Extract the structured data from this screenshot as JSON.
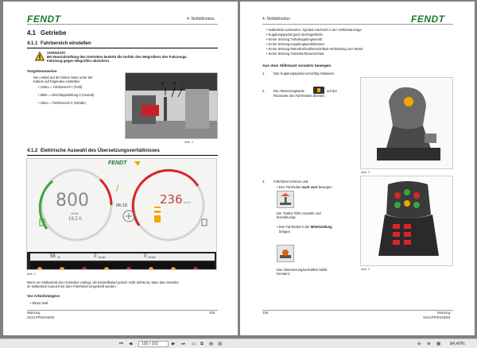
{
  "left_page": {
    "logo": "FENDT",
    "chapter": "4. Notfallmodus",
    "section_number": "4.1",
    "section_title": "Getriebe",
    "sub1_number": "4.1.1",
    "sub1_title": "Fahrbereich einstellen",
    "warning_title": "VORSICHT:",
    "warning_line1": "Bei Neutralstellung des Getriebes besteht die Gefahr des Wegrollens des Fahrzeugs.",
    "warning_line2": "Fahrzeug gegen Wegrollen absichern.",
    "procedure_title": "Vorgehensweise",
    "procedure_intro1": "Den Hebel auf der linken Seite unter der",
    "procedure_intro2": "Kabine auf folgendes einstellen",
    "bullets": [
      "Unten = Fahrbereich I (Feld)",
      "Mitte = Abschleppstellung 0 (neutral)",
      "Oben = Fahrbereich II (Straße)"
    ],
    "fig1_caption": "Abb. 1",
    "fig1_labels": [
      "II",
      "0",
      "I"
    ],
    "sub2_number": "4.1.2",
    "sub2_title": "Elektrische Auswahl des Übersetzungsverhältnisses",
    "dashboard": {
      "brand": "FENDT",
      "rpm_value": "800",
      "rpm_unit": "1/min",
      "hours_value": "19,2 h",
      "time": "06:19",
      "speed_value": "236",
      "speed_unit": "km/h",
      "bottom_pct": "58",
      "bottom_pct_unit": "%",
      "bottom_rpm1": "0",
      "bottom_rpm1_unit": "1/min",
      "bottom_rpm2": "0",
      "bottom_rpm2_unit": "1/min"
    },
    "fig2_caption": "Abb. 2",
    "para1": "Wenn ein Notbetrieb des Getriebes vorliegt, die Einstellhebel jedoch nicht defekt ist, kann das Getriebe",
    "para2": "im Notbetrieb manuell mit dem Fahrhebel eingestellt werden.",
    "before_title": "Vor Arbeitsbeginn",
    "before_bullet": "Motor läuft",
    "footer_left1": "Wartung",
    "footer_left2": "SS21PP001N003",
    "page_number": "105"
  },
  "right_page": {
    "logo": "FENDT",
    "chapter": "4. Notfallmodus",
    "bullets": [
      "Notbetrieb vorhanden; Symbol erscheint in der Vielfachanzeige.",
      "Kupplungspedal ganz durchgedrückt.",
      "Keine Störung Turbokupplungsventil.",
      "Keine Störung Kupplungspedalsensor.",
      "Keine Störung Motordrehzahlsensor/Bus-Verbindung zum Motor.",
      "Keine Störung Getriebe/Steuereinheit."
    ],
    "from_stop_title": "Aus dem Stillstand vorwärts bewegen",
    "step1_num": "1.",
    "step1_text": "Das Kupplungspedal vorsichtig loslassen.",
    "step2_num": "2.",
    "step2_text_a": "Die Aktivierungstaste",
    "step2_text_b": "auf der",
    "step2_text_c": "Rückseite des Fahrhebels drücken.",
    "fig3_caption": "Abb. 3",
    "step3_num": "3.",
    "step3_text": "Fahrhebel nehmen und:",
    "sub_a_prefix": "Den Fahrhebel",
    "sub_a_bold": "nach vorn",
    "sub_a_suffix": "bewegen.",
    "result_a1": "Der Traktor fährt vorwärts und",
    "result_a2": "beschleunigt.",
    "sub_b_prefix": "Den Fahrhebel in die",
    "sub_b_bold": "Mittelstellung",
    "sub_b_suffix": "bringen.",
    "result_b1": "Das Übersetzungsverhältnis bleibt",
    "result_b2": "konstant.",
    "fig4_caption": "Abb. 4",
    "footer_left": "106",
    "footer_right1": "Wartung",
    "footer_right2": "SS21PP001N003"
  },
  "toolbar": {
    "page_input": "105 / 162",
    "zoom": "84,40%"
  },
  "colors": {
    "fendt_green": "#1a7a2e",
    "warning_yellow": "#f2c200",
    "dash_red": "#d9252a",
    "dash_green": "#3aa53a"
  }
}
